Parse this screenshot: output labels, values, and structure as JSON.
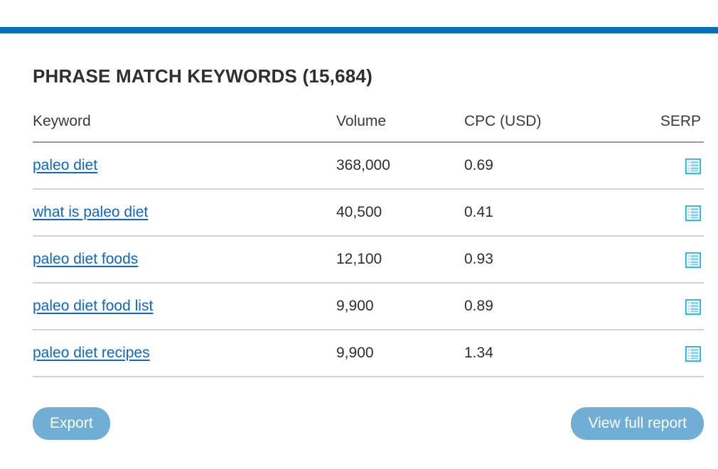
{
  "theme": {
    "accent_bar_color": "#0770bc",
    "link_color": "#1065c8",
    "button_color": "#71aed6",
    "title_color": "#2f2f2f",
    "header_rule_color": "#9a9a9a",
    "row_rule_color": "#d2d2d2"
  },
  "panel": {
    "title": "PHRASE MATCH KEYWORDS (15,684)"
  },
  "table": {
    "columns": [
      {
        "key": "keyword",
        "label": "Keyword"
      },
      {
        "key": "volume",
        "label": "Volume"
      },
      {
        "key": "cpc",
        "label": "CPC (USD)"
      },
      {
        "key": "serp",
        "label": "SERP"
      }
    ],
    "rows": [
      {
        "keyword": "paleo diet",
        "volume": "368,000",
        "cpc": "0.69",
        "serp_icon": "serp-list-icon"
      },
      {
        "keyword": "what is paleo diet",
        "volume": "40,500",
        "cpc": "0.41",
        "serp_icon": "serp-list-icon"
      },
      {
        "keyword": "paleo diet foods",
        "volume": "12,100",
        "cpc": "0.93",
        "serp_icon": "serp-list-icon"
      },
      {
        "keyword": "paleo diet food list",
        "volume": "9,900",
        "cpc": "0.89",
        "serp_icon": "serp-list-icon"
      },
      {
        "keyword": "paleo diet recipes",
        "volume": "9,900",
        "cpc": "1.34",
        "serp_icon": "serp-list-icon"
      }
    ]
  },
  "footer": {
    "export_label": "Export",
    "view_report_label": "View full report"
  }
}
